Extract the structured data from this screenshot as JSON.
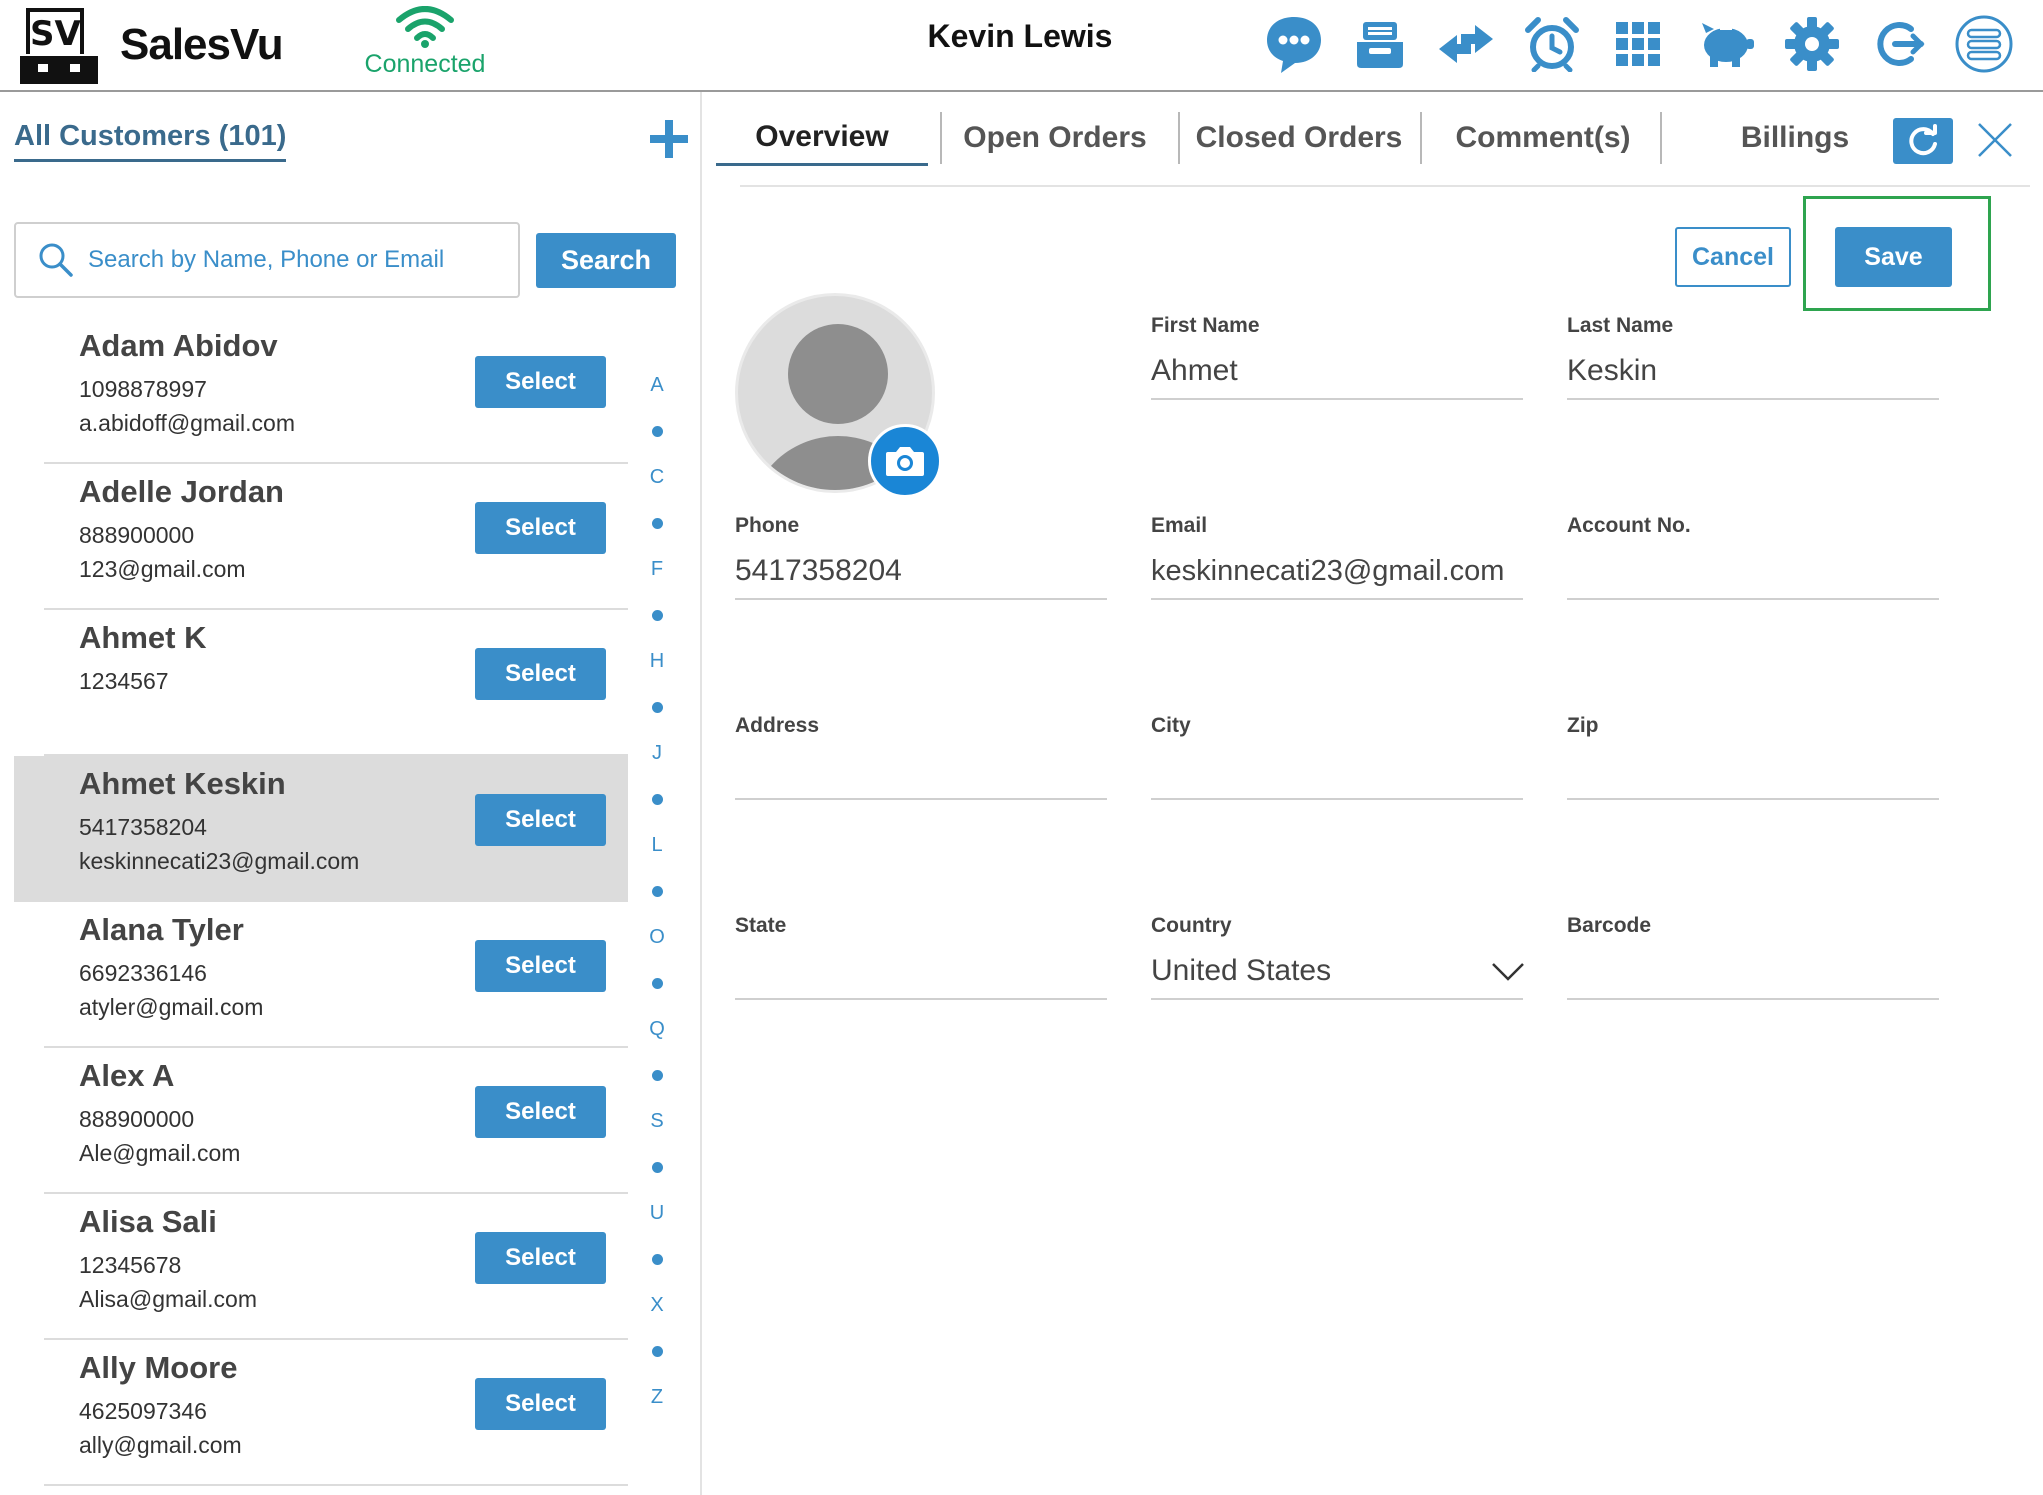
{
  "header": {
    "brand": "SalesVu",
    "logo_text": "SV",
    "connection_status": "Connected",
    "user_name": "Kevin Lewis",
    "icons": [
      "chat-icon",
      "register-icon",
      "transfer-icon",
      "alarm-icon",
      "grid-icon",
      "piggy-bank-icon",
      "gear-icon",
      "logout-icon",
      "menu-icon"
    ]
  },
  "colors": {
    "accent": "#3a8ec9",
    "connected": "#1aa36b",
    "highlight": "#2ea44f",
    "title": "#3a6a8c"
  },
  "sidebar": {
    "title": "All Customers (101)",
    "search_placeholder": "Search by Name, Phone or Email",
    "search_value": "",
    "search_button": "Search",
    "select_label": "Select",
    "customers": [
      {
        "name": "Adam Abidov",
        "phone": "1098878997",
        "email": "a.abidoff@gmail.com",
        "selected": false
      },
      {
        "name": "Adelle Jordan",
        "phone": "888900000",
        "email": "123@gmail.com",
        "selected": false
      },
      {
        "name": "Ahmet K",
        "phone": "1234567",
        "email": "",
        "selected": false
      },
      {
        "name": "Ahmet Keskin",
        "phone": "5417358204",
        "email": "keskinnecati23@gmail.com",
        "selected": true
      },
      {
        "name": "Alana Tyler",
        "phone": "6692336146",
        "email": "atyler@gmail.com",
        "selected": false
      },
      {
        "name": "Alex A",
        "phone": "888900000",
        "email": "Ale@gmail.com",
        "selected": false
      },
      {
        "name": "Alisa Sali",
        "phone": "12345678",
        "email": "Alisa@gmail.com",
        "selected": false
      },
      {
        "name": "Ally Moore",
        "phone": "4625097346",
        "email": "ally@gmail.com",
        "selected": false
      }
    ],
    "alphabet": [
      "A",
      "•",
      "C",
      "•",
      "F",
      "•",
      "H",
      "•",
      "J",
      "•",
      "L",
      "•",
      "O",
      "•",
      "Q",
      "•",
      "S",
      "•",
      "U",
      "•",
      "X",
      "•",
      "Z"
    ]
  },
  "detail": {
    "tabs": [
      "Overview",
      "Open Orders",
      "Closed Orders",
      "Comment(s)",
      "Billings"
    ],
    "active_tab": "Overview",
    "cancel_label": "Cancel",
    "save_label": "Save",
    "fields": {
      "first_name": {
        "label": "First Name",
        "value": "Ahmet"
      },
      "last_name": {
        "label": "Last Name",
        "value": "Keskin"
      },
      "phone": {
        "label": "Phone",
        "value": "5417358204"
      },
      "email": {
        "label": "Email",
        "value": "keskinnecati23@gmail.com"
      },
      "account_no": {
        "label": "Account No.",
        "value": ""
      },
      "address": {
        "label": "Address",
        "value": ""
      },
      "city": {
        "label": "City",
        "value": ""
      },
      "zip": {
        "label": "Zip",
        "value": ""
      },
      "state": {
        "label": "State",
        "value": ""
      },
      "country": {
        "label": "Country",
        "value": "United States"
      },
      "barcode": {
        "label": "Barcode",
        "value": ""
      }
    }
  }
}
